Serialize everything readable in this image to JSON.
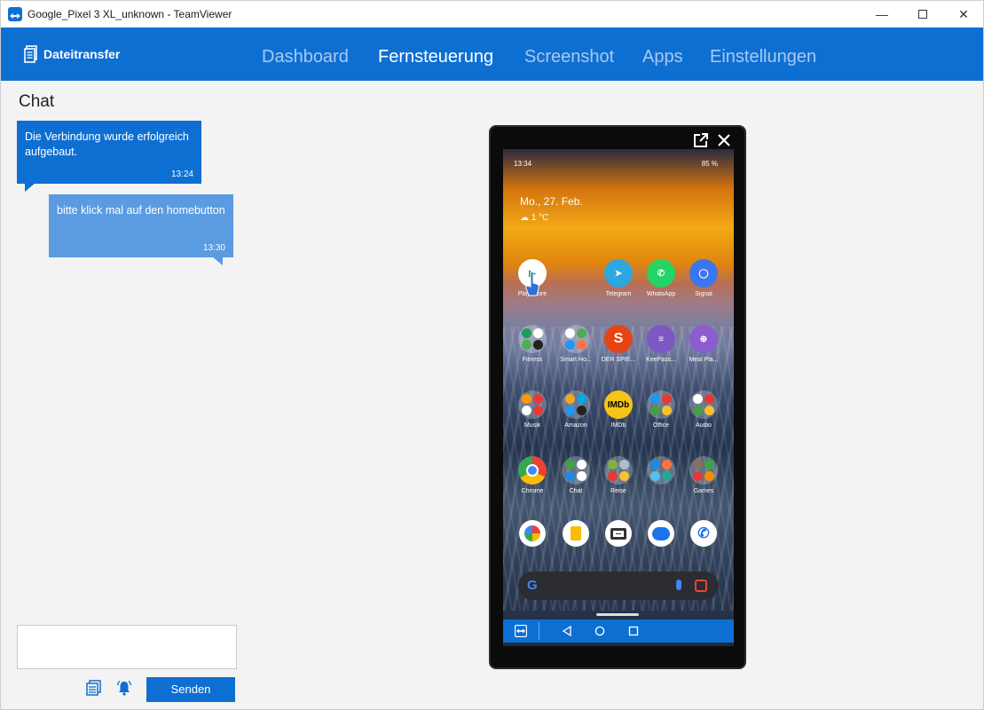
{
  "window": {
    "title": "Google_Pixel 3 XL_unknown - TeamViewer",
    "min": "—",
    "close": "✕"
  },
  "nav": {
    "file_transfer": "Dateitransfer",
    "tabs": [
      {
        "label": "Dashboard",
        "active": false
      },
      {
        "label": "Fernsteuerung",
        "active": true
      },
      {
        "label": "Screenshot",
        "active": false
      },
      {
        "label": "Apps",
        "active": false
      },
      {
        "label": "Einstellungen",
        "active": false
      }
    ]
  },
  "chat": {
    "title": "Chat",
    "messages": [
      {
        "text": "Die Verbindung wurde erfolgreich aufgebaut.",
        "time": "13:24",
        "side": "left"
      },
      {
        "text": "bitte klick mal auf den homebutton",
        "time": "13:30",
        "side": "right"
      }
    ],
    "input_value": "",
    "send_label": "Senden"
  },
  "phone": {
    "status_time": "13:34",
    "battery": "85 %",
    "date": "Mo., 27. Feb.",
    "temp": "1 °C",
    "row1": [
      {
        "label": "Play Store",
        "color": "#ffffff",
        "glyph": "▶"
      },
      {
        "label": "Telegram",
        "color": "#2ea6e0",
        "glyph": "➤"
      },
      {
        "label": "WhatsApp",
        "color": "#25d366",
        "glyph": "✆"
      },
      {
        "label": "Signal",
        "color": "#3a76f0",
        "glyph": "◯"
      }
    ],
    "row2": [
      "Fitness",
      "Smart Ho...",
      "DER SPIE...",
      "KeePass...",
      "Meal Pla..."
    ],
    "row3": [
      "Musik",
      "Amazon",
      "IMDb",
      "Office",
      "Audio"
    ],
    "row4": [
      "Chrome",
      "Chat",
      "Reise",
      "",
      "Games"
    ],
    "dock": [
      "photos",
      "keep",
      "camera",
      "messages",
      "phone"
    ],
    "accent": "#0e6fd3"
  }
}
